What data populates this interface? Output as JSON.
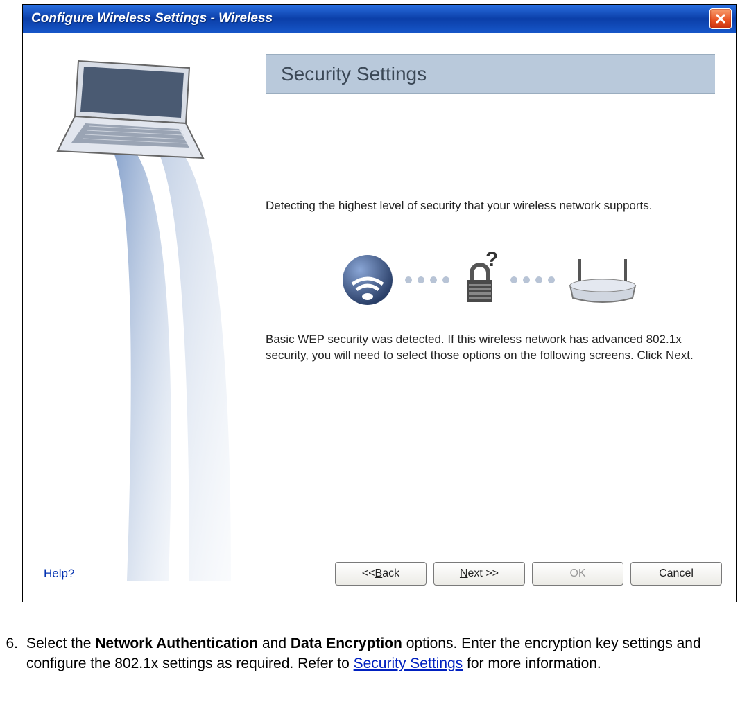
{
  "dialog": {
    "title": "Configure Wireless Settings  -  Wireless",
    "header": "Security Settings",
    "desc1": "Detecting the highest level of security that your wireless network supports.",
    "desc2": "Basic WEP security was detected. If this wireless network has advanced 802.1x security, you will need to select those options on the following screens. Click Next.",
    "help": "Help?",
    "buttons": {
      "back_prefix": "<< ",
      "back_letter": "B",
      "back_rest": "ack",
      "next_letter": "N",
      "next_rest": "ext >>",
      "ok": "OK",
      "cancel": "Cancel"
    }
  },
  "instruction": {
    "number": "6.",
    "t1": "Select the ",
    "b1": "Network Authentication",
    "t2": " and ",
    "b2": "Data Encryption",
    "t3": " options. Enter the encryption key settings and configure the 802.1x settings as required. Refer to ",
    "link": "Security Settings",
    "t4": " for more information."
  }
}
